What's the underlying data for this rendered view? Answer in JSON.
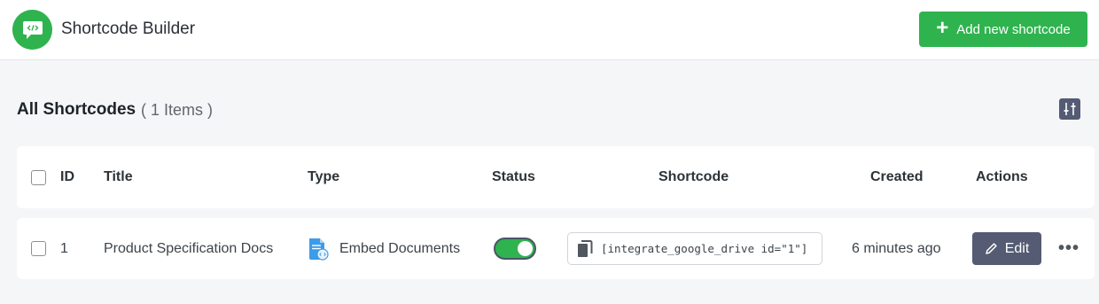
{
  "header": {
    "app_title": "Shortcode Builder",
    "add_button_label": "Add new shortcode",
    "brand_color": "#2fb34f"
  },
  "section": {
    "title": "All Shortcodes",
    "count_label": "( 1 Items )"
  },
  "table": {
    "columns": [
      "ID",
      "Title",
      "Type",
      "Status",
      "Shortcode",
      "Created",
      "Actions"
    ],
    "rows": [
      {
        "id": "1",
        "title": "Product Specification Docs",
        "type": "Embed Documents",
        "status_enabled": true,
        "shortcode": "[integrate_google_drive id=\"1\"]",
        "created": "6 minutes ago",
        "edit_label": "Edit",
        "more_label": "•••"
      }
    ]
  },
  "icons": {
    "logo": "code-chat-icon",
    "add": "plus-icon",
    "settings": "column-settings-icon",
    "type": "document-code-icon",
    "copy": "copy-icon",
    "edit": "pencil-icon",
    "more": "more-horizontal-icon"
  }
}
